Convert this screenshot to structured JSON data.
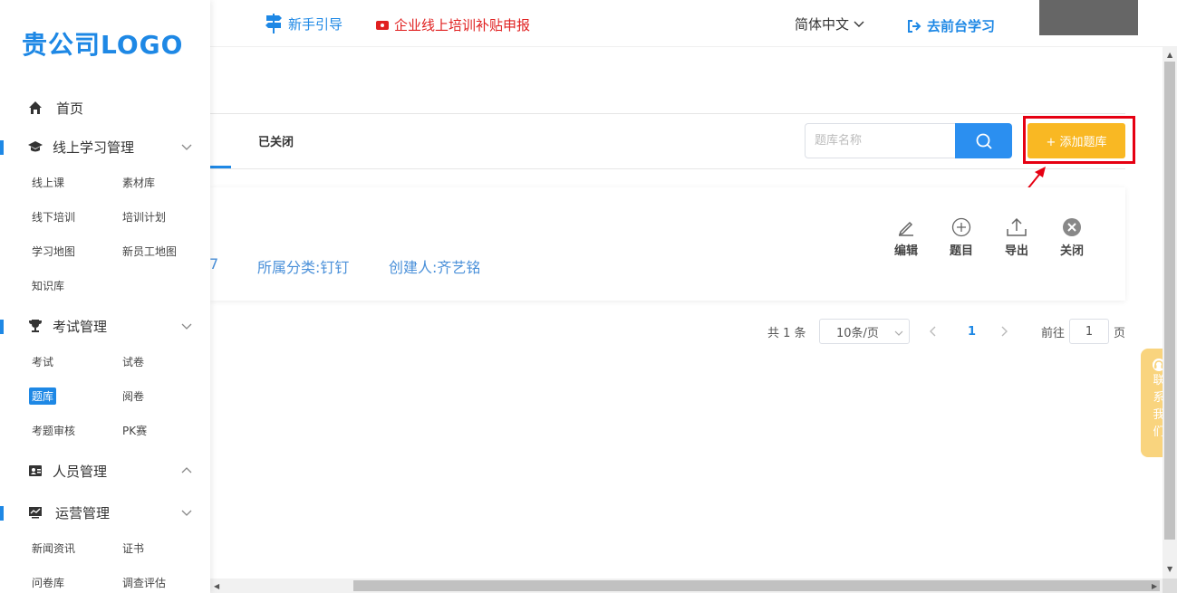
{
  "logo": "贵公司LOGO",
  "topbar": {
    "guide": "新手引导",
    "subsidy": "企业线上培训补贴申报",
    "language": "简体中文",
    "front": "去前台学习"
  },
  "sidebar": {
    "home": "首页",
    "online": {
      "label": "线上学习管理",
      "items": [
        "线上课",
        "素材库",
        "线下培训",
        "培训计划",
        "学习地图",
        "新员工地图",
        "知识库"
      ]
    },
    "exam": {
      "label": "考试管理",
      "items": [
        "考试",
        "试卷",
        "题库",
        "阅卷",
        "考题审核",
        "PK赛"
      ]
    },
    "people": {
      "label": "人员管理"
    },
    "ops": {
      "label": "运营管理",
      "items": [
        "新闻资讯",
        "证书",
        "问卷库",
        "调查评估"
      ]
    }
  },
  "tabs": {
    "closed": "已关闭"
  },
  "search": {
    "placeholder": "题库名称"
  },
  "add_button": "+ 添加题库",
  "card": {
    "partial_number": "7",
    "category": "所属分类:钉钉",
    "creator": "创建人:齐艺铭",
    "actions": [
      "编辑",
      "题目",
      "导出",
      "关闭"
    ]
  },
  "pagination": {
    "total": "共 1 条",
    "page_size": "10条/页",
    "current_page": "1",
    "goto_label": "前往",
    "goto_value": "1",
    "page_suffix": "页"
  },
  "contact": [
    "联",
    "系",
    "我",
    "们"
  ],
  "colors": {
    "primary": "#1e88e5",
    "accent": "#f9b823",
    "highlight": "#e60012",
    "subsidy": "#e02020"
  }
}
